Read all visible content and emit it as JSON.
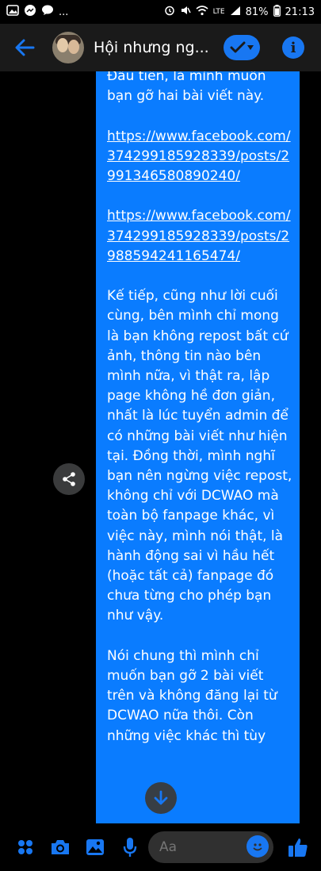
{
  "status_bar": {
    "time": "21:13",
    "battery": "81%",
    "network": "LTE",
    "more": "...",
    "icons": [
      "gallery-icon",
      "messenger-icon",
      "chat-icon",
      "alarm-icon",
      "mute-icon",
      "wifi-icon",
      "signal-icon",
      "battery-icon"
    ]
  },
  "header": {
    "title": "Hội nhưng ng...",
    "back_icon": "back-arrow-icon",
    "check_icon": "check-icon",
    "dropdown_icon": "chevron-down-icon",
    "info_icon": "info-icon",
    "info_label": "i"
  },
  "message": {
    "paragraphs": [
      {
        "type": "text",
        "text": "Đầu tiên, là mình muốn bạn gỡ hai bài viết này."
      },
      {
        "type": "link",
        "text": "https://www.facebook.com/374299185928339/posts/2991346580890240/"
      },
      {
        "type": "link",
        "text": "https://www.facebook.com/374299185928339/posts/2988594241165474/"
      },
      {
        "type": "text",
        "text": "Kế tiếp, cũng như lời cuối cùng, bên mình chỉ mong là bạn không repost bất cứ ảnh, thông tin nào bên mình nữa, vì thật ra, lập page không hề đơn giản, nhất là lúc tuyển admin để có những bài viết như hiện tại. Đồng thời, mình nghĩ bạn nên ngừng việc repost, không chỉ với DCWAO mà toàn bộ fanpage khác, vì việc này, mình nói thật, là hành động sai vì hầu hết (hoặc tất cả) fanpage đó chưa từng cho phép bạn như vậy."
      },
      {
        "type": "text",
        "text": "Nói chung thì mình chỉ muốn bạn gỡ 2 bài viết trên và không đăng lại từ DCWAO nữa thôi. Còn những việc khác thì tùy"
      }
    ]
  },
  "composer": {
    "placeholder": "Aa",
    "icons": [
      "menu-dots-icon",
      "camera-icon",
      "image-icon",
      "microphone-icon",
      "emoji-icon",
      "like-icon"
    ]
  },
  "colors": {
    "accent": "#1877f2",
    "bubble": "#0a7cff",
    "background": "#000000",
    "header": "#1a1a1a"
  }
}
